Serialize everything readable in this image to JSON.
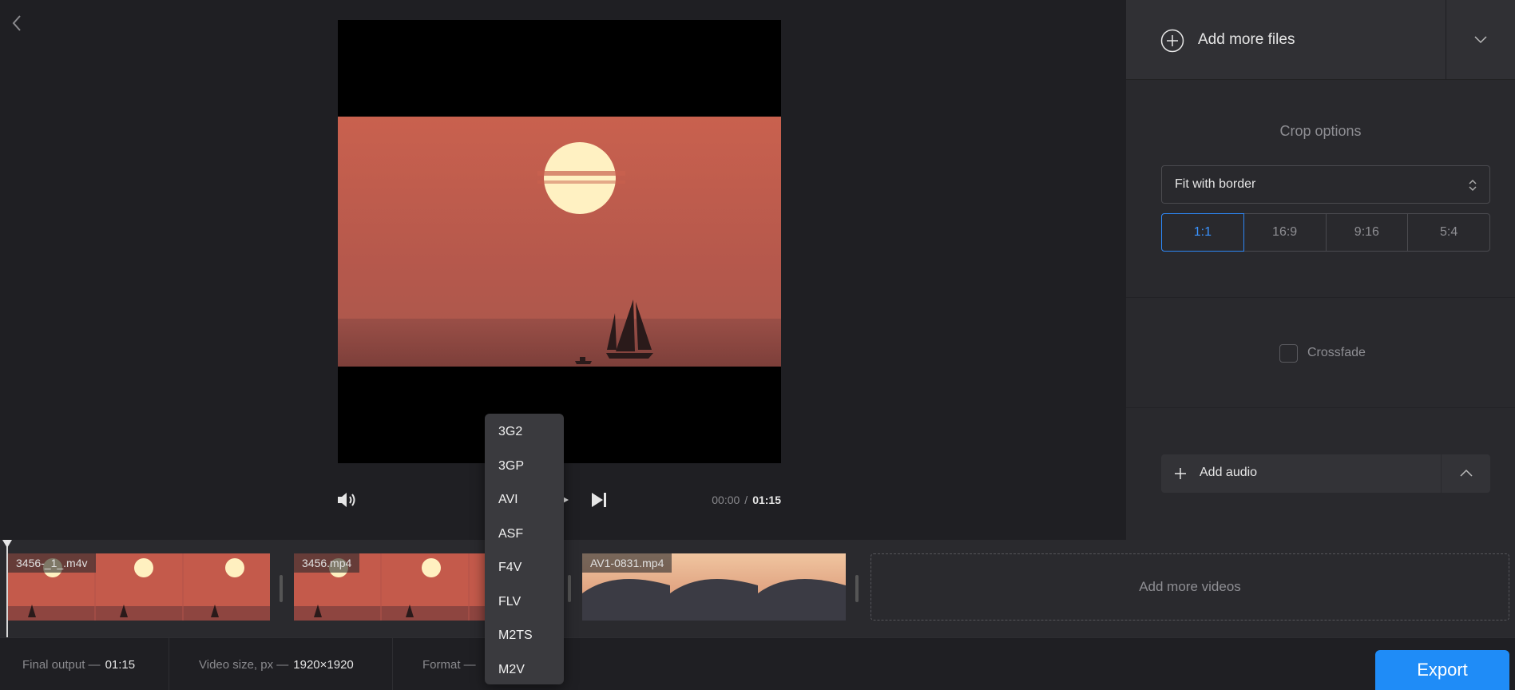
{
  "editor": {
    "back_icon": "chevron-left-icon",
    "timecode": {
      "current": "00:00",
      "separator": "/",
      "total": "01:15"
    }
  },
  "panel": {
    "add_files_label": "Add more files",
    "crop": {
      "title": "Crop options",
      "mode": "Fit with border",
      "ratios": [
        "1:1",
        "16:9",
        "9:16",
        "5:4"
      ],
      "active_ratio": "1:1"
    },
    "crossfade": {
      "label": "Crossfade",
      "checked": false
    },
    "add_audio_label": "Add audio"
  },
  "timeline": {
    "clips": [
      {
        "name": "3456-_1_.m4v"
      },
      {
        "name": "3456.mp4"
      },
      {
        "name": "AV1-0831.mp4"
      }
    ],
    "add_videos_label": "Add more videos"
  },
  "bottombar": {
    "final_output": {
      "label": "Final output —",
      "value": "01:15"
    },
    "video_size": {
      "label": "Video size, px —",
      "value": "1920×1920"
    },
    "format": {
      "label": "Format —"
    },
    "export_label": "Export"
  },
  "format_dropdown": {
    "options": [
      "3G2",
      "3GP",
      "AVI",
      "ASF",
      "F4V",
      "FLV",
      "M2TS",
      "M2V"
    ]
  },
  "colors": {
    "accent": "#1f8cf7",
    "panel_bg": "#29292d",
    "app_bg": "#1f1f23"
  }
}
